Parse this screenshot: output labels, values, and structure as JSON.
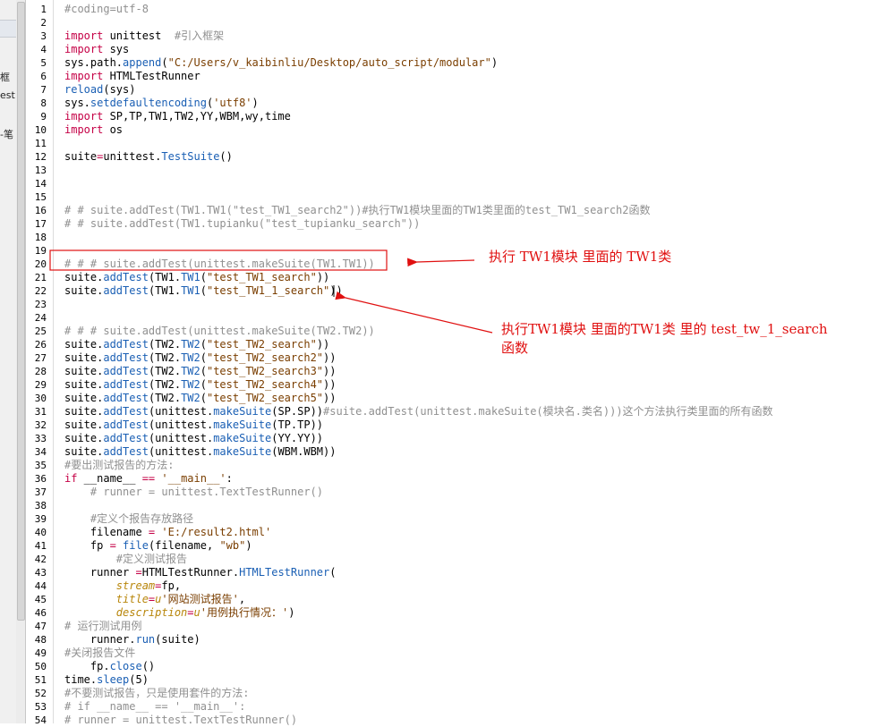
{
  "left_strip": {
    "fragments": [
      "框",
      "est",
      "-笔"
    ]
  },
  "lines": [
    {
      "n": "1",
      "segs": [
        {
          "t": "#coding=utf-8",
          "c": "cm"
        }
      ]
    },
    {
      "n": "2",
      "segs": []
    },
    {
      "n": "3",
      "segs": [
        {
          "t": "import",
          "c": "kw"
        },
        {
          "t": " unittest  "
        },
        {
          "t": "#引入框架",
          "c": "cm"
        }
      ]
    },
    {
      "n": "4",
      "segs": [
        {
          "t": "import",
          "c": "kw"
        },
        {
          "t": " sys"
        }
      ]
    },
    {
      "n": "5",
      "segs": [
        {
          "t": "sys.path."
        },
        {
          "t": "append",
          "c": "fn"
        },
        {
          "t": "("
        },
        {
          "t": "\"C:/Users/v_kaibinliu/Desktop/auto_script/modular\"",
          "c": "str"
        },
        {
          "t": ")"
        }
      ]
    },
    {
      "n": "6",
      "segs": [
        {
          "t": "import",
          "c": "kw"
        },
        {
          "t": " HTMLTestRunner"
        }
      ]
    },
    {
      "n": "7",
      "segs": [
        {
          "t": "reload",
          "c": "fn"
        },
        {
          "t": "(sys)"
        }
      ]
    },
    {
      "n": "8",
      "segs": [
        {
          "t": "sys."
        },
        {
          "t": "setdefaultencoding",
          "c": "fn"
        },
        {
          "t": "("
        },
        {
          "t": "'utf8'",
          "c": "str"
        },
        {
          "t": ")"
        }
      ]
    },
    {
      "n": "9",
      "segs": [
        {
          "t": "import",
          "c": "kw"
        },
        {
          "t": " SP,TP,TW1,TW2,YY,WBM,wy,time"
        }
      ]
    },
    {
      "n": "10",
      "segs": [
        {
          "t": "import",
          "c": "kw"
        },
        {
          "t": " os"
        }
      ]
    },
    {
      "n": "11",
      "segs": []
    },
    {
      "n": "12",
      "segs": [
        {
          "t": "suite"
        },
        {
          "t": "=",
          "c": "kw"
        },
        {
          "t": "unittest."
        },
        {
          "t": "TestSuite",
          "c": "fn"
        },
        {
          "t": "()"
        }
      ]
    },
    {
      "n": "13",
      "segs": []
    },
    {
      "n": "14",
      "segs": []
    },
    {
      "n": "15",
      "segs": []
    },
    {
      "n": "16",
      "segs": [
        {
          "t": "# # suite.addTest(TW1.TW1(\"test_TW1_search2\"))#执行TW1模块里面的TW1类里面的test_TW1_search2函数",
          "c": "cm"
        }
      ]
    },
    {
      "n": "17",
      "segs": [
        {
          "t": "# # suite.addTest(TW1.tupianku(\"test_tupianku_search\"))",
          "c": "cm"
        }
      ]
    },
    {
      "n": "18",
      "segs": []
    },
    {
      "n": "19",
      "segs": []
    },
    {
      "n": "20",
      "segs": [
        {
          "t": "# # # suite.addTest(unittest.makeSuite(TW1.TW1))",
          "c": "cm"
        }
      ]
    },
    {
      "n": "21",
      "segs": [
        {
          "t": "suite."
        },
        {
          "t": "addTest",
          "c": "fn"
        },
        {
          "t": "(TW1."
        },
        {
          "t": "TW1",
          "c": "fn"
        },
        {
          "t": "("
        },
        {
          "t": "\"test_TW1_search\"",
          "c": "str"
        },
        {
          "t": "))"
        }
      ]
    },
    {
      "n": "22",
      "segs": [
        {
          "t": "suite."
        },
        {
          "t": "addTest",
          "c": "fn"
        },
        {
          "t": "(TW1."
        },
        {
          "t": "TW1",
          "c": "fn"
        },
        {
          "t": "("
        },
        {
          "t": "\"test_TW1_1_search\"",
          "c": "str"
        },
        {
          "t": "))"
        }
      ]
    },
    {
      "n": "23",
      "segs": []
    },
    {
      "n": "24",
      "segs": []
    },
    {
      "n": "25",
      "segs": [
        {
          "t": "# # # suite.addTest(unittest.makeSuite(TW2.TW2))",
          "c": "cm"
        }
      ]
    },
    {
      "n": "26",
      "segs": [
        {
          "t": "suite."
        },
        {
          "t": "addTest",
          "c": "fn"
        },
        {
          "t": "(TW2."
        },
        {
          "t": "TW2",
          "c": "fn"
        },
        {
          "t": "("
        },
        {
          "t": "\"test_TW2_search\"",
          "c": "str"
        },
        {
          "t": "))"
        }
      ]
    },
    {
      "n": "27",
      "segs": [
        {
          "t": "suite."
        },
        {
          "t": "addTest",
          "c": "fn"
        },
        {
          "t": "(TW2."
        },
        {
          "t": "TW2",
          "c": "fn"
        },
        {
          "t": "("
        },
        {
          "t": "\"test_TW2_search2\"",
          "c": "str"
        },
        {
          "t": "))"
        }
      ]
    },
    {
      "n": "28",
      "segs": [
        {
          "t": "suite."
        },
        {
          "t": "addTest",
          "c": "fn"
        },
        {
          "t": "(TW2."
        },
        {
          "t": "TW2",
          "c": "fn"
        },
        {
          "t": "("
        },
        {
          "t": "\"test_TW2_search3\"",
          "c": "str"
        },
        {
          "t": "))"
        }
      ]
    },
    {
      "n": "29",
      "segs": [
        {
          "t": "suite."
        },
        {
          "t": "addTest",
          "c": "fn"
        },
        {
          "t": "(TW2."
        },
        {
          "t": "TW2",
          "c": "fn"
        },
        {
          "t": "("
        },
        {
          "t": "\"test_TW2_search4\"",
          "c": "str"
        },
        {
          "t": "))"
        }
      ]
    },
    {
      "n": "30",
      "segs": [
        {
          "t": "suite."
        },
        {
          "t": "addTest",
          "c": "fn"
        },
        {
          "t": "(TW2."
        },
        {
          "t": "TW2",
          "c": "fn"
        },
        {
          "t": "("
        },
        {
          "t": "\"test_TW2_search5\"",
          "c": "str"
        },
        {
          "t": "))"
        }
      ]
    },
    {
      "n": "31",
      "segs": [
        {
          "t": "suite."
        },
        {
          "t": "addTest",
          "c": "fn"
        },
        {
          "t": "(unittest."
        },
        {
          "t": "makeSuite",
          "c": "fn"
        },
        {
          "t": "(SP.SP))"
        },
        {
          "t": "#suite.addTest(unittest.makeSuite(模块名.类名)))这个方法执行类里面的所有函数",
          "c": "cm"
        }
      ]
    },
    {
      "n": "32",
      "segs": [
        {
          "t": "suite."
        },
        {
          "t": "addTest",
          "c": "fn"
        },
        {
          "t": "(unittest."
        },
        {
          "t": "makeSuite",
          "c": "fn"
        },
        {
          "t": "(TP.TP))"
        }
      ]
    },
    {
      "n": "33",
      "segs": [
        {
          "t": "suite."
        },
        {
          "t": "addTest",
          "c": "fn"
        },
        {
          "t": "(unittest."
        },
        {
          "t": "makeSuite",
          "c": "fn"
        },
        {
          "t": "(YY.YY))"
        }
      ]
    },
    {
      "n": "34",
      "segs": [
        {
          "t": "suite."
        },
        {
          "t": "addTest",
          "c": "fn"
        },
        {
          "t": "(unittest."
        },
        {
          "t": "makeSuite",
          "c": "fn"
        },
        {
          "t": "(WBM.WBM))"
        }
      ]
    },
    {
      "n": "35",
      "segs": [
        {
          "t": "#要出测试报告的方法:",
          "c": "cm"
        }
      ]
    },
    {
      "n": "36",
      "segs": [
        {
          "t": "if",
          "c": "kw"
        },
        {
          "t": " __name__ "
        },
        {
          "t": "==",
          "c": "kw"
        },
        {
          "t": " "
        },
        {
          "t": "'__main__'",
          "c": "str"
        },
        {
          "t": ":"
        }
      ]
    },
    {
      "n": "37",
      "segs": [
        {
          "t": "    "
        },
        {
          "t": "# runner = unittest.TextTestRunner()",
          "c": "cm"
        }
      ]
    },
    {
      "n": "38",
      "segs": []
    },
    {
      "n": "39",
      "segs": [
        {
          "t": "    "
        },
        {
          "t": "#定义个报告存放路径",
          "c": "cm"
        }
      ]
    },
    {
      "n": "40",
      "segs": [
        {
          "t": "    filename "
        },
        {
          "t": "=",
          "c": "kw"
        },
        {
          "t": " "
        },
        {
          "t": "'E:/result2.html'",
          "c": "str"
        }
      ]
    },
    {
      "n": "41",
      "segs": [
        {
          "t": "    fp "
        },
        {
          "t": "=",
          "c": "kw"
        },
        {
          "t": " "
        },
        {
          "t": "file",
          "c": "fn"
        },
        {
          "t": "(filename, "
        },
        {
          "t": "\"wb\"",
          "c": "str"
        },
        {
          "t": ")"
        }
      ]
    },
    {
      "n": "42",
      "segs": [
        {
          "t": "        "
        },
        {
          "t": "#定义测试报告",
          "c": "cm"
        }
      ]
    },
    {
      "n": "43",
      "segs": [
        {
          "t": "    runner "
        },
        {
          "t": "=",
          "c": "kw"
        },
        {
          "t": "HTMLTestRunner."
        },
        {
          "t": "HTMLTestRunner",
          "c": "fn"
        },
        {
          "t": "("
        }
      ]
    },
    {
      "n": "44",
      "segs": [
        {
          "t": "        "
        },
        {
          "t": "stream",
          "c": "arg"
        },
        {
          "t": "=",
          "c": "kw"
        },
        {
          "t": "fp,"
        }
      ]
    },
    {
      "n": "45",
      "segs": [
        {
          "t": "        "
        },
        {
          "t": "title",
          "c": "arg"
        },
        {
          "t": "=",
          "c": "kw"
        },
        {
          "t": "u",
          "c": "arg"
        },
        {
          "t": "'网站测试报告'",
          "c": "str"
        },
        {
          "t": ","
        }
      ]
    },
    {
      "n": "46",
      "segs": [
        {
          "t": "        "
        },
        {
          "t": "description",
          "c": "arg"
        },
        {
          "t": "=",
          "c": "kw"
        },
        {
          "t": "u",
          "c": "arg"
        },
        {
          "t": "'用例执行情况：'",
          "c": "str"
        },
        {
          "t": ")"
        }
      ]
    },
    {
      "n": "47",
      "segs": [
        {
          "t": "# 运行测试用例",
          "c": "cm"
        }
      ]
    },
    {
      "n": "48",
      "segs": [
        {
          "t": "    runner."
        },
        {
          "t": "run",
          "c": "fn"
        },
        {
          "t": "(suite)"
        }
      ]
    },
    {
      "n": "49",
      "segs": [
        {
          "t": "#关闭报告文件",
          "c": "cm"
        }
      ]
    },
    {
      "n": "50",
      "segs": [
        {
          "t": "    fp."
        },
        {
          "t": "close",
          "c": "fn"
        },
        {
          "t": "()"
        }
      ]
    },
    {
      "n": "51",
      "segs": [
        {
          "t": "time."
        },
        {
          "t": "sleep",
          "c": "fn"
        },
        {
          "t": "(5)"
        }
      ]
    },
    {
      "n": "52",
      "segs": [
        {
          "t": "#不要测试报告，只是使用套件的方法:",
          "c": "cm"
        }
      ]
    },
    {
      "n": "53",
      "segs": [
        {
          "t": "# if __name__ == '__main__':",
          "c": "cm"
        }
      ]
    },
    {
      "n": "54",
      "segs": [
        {
          "t": "# runner = unittest.TextTestRunner()",
          "c": "cm"
        }
      ]
    }
  ],
  "annotations": {
    "a1": "执行 TW1模块 里面的 TW1类",
    "a2_line1": "执行TW1模块 里面的TW1类 里的 test_tw_1_search",
    "a2_line2": "函数"
  },
  "colors": {
    "annotation": "#e01010",
    "comment": "#909090",
    "keyword": "#c50046",
    "function": "#1a5fb4",
    "string": "#7a3e00"
  }
}
